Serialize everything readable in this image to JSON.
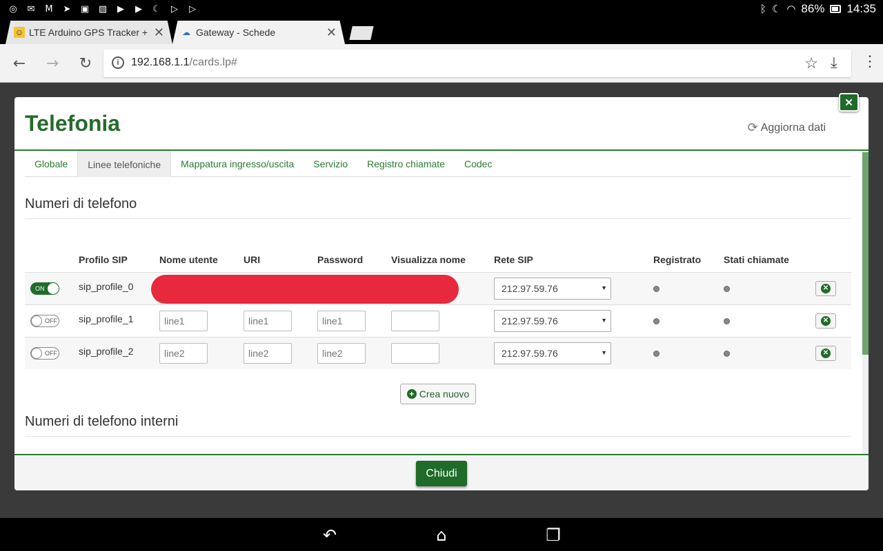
{
  "status_bar": {
    "battery": "86%",
    "time": "14:35"
  },
  "browser": {
    "tabs": [
      {
        "title": "LTE Arduino GPS Tracker + Io",
        "active": false
      },
      {
        "title": "Gateway - Schede",
        "active": true
      }
    ],
    "url_host": "192.168.1.1",
    "url_path": "/cards.lp#"
  },
  "modal": {
    "title": "Telefonia",
    "refresh_label": "Aggiorna dati",
    "close_label": "Chiudi",
    "tabs": [
      {
        "label": "Globale",
        "active": false
      },
      {
        "label": "Linee telefoniche",
        "active": true
      },
      {
        "label": "Mappatura ingresso/uscita",
        "active": false
      },
      {
        "label": "Servizio",
        "active": false
      },
      {
        "label": "Registro chiamate",
        "active": false
      },
      {
        "label": "Codec",
        "active": false
      }
    ],
    "section1_title": "Numeri di telefono",
    "section2_title": "Numeri di telefono interni",
    "table": {
      "headers": [
        "Profilo SIP",
        "Nome utente",
        "URI",
        "Password",
        "Visualizza nome",
        "Rete SIP",
        "Registrato",
        "Stati chiamate"
      ],
      "rows": [
        {
          "switch": "ON",
          "profile": "sip_profile_0",
          "username": "",
          "uri": "",
          "password": "",
          "display_name": "",
          "network": "212.97.59.76",
          "redacted": true
        },
        {
          "switch": "OFF",
          "profile": "sip_profile_1",
          "username": "line1",
          "uri": "line1",
          "password": "line1",
          "display_name": "",
          "network": "212.97.59.76",
          "redacted": false
        },
        {
          "switch": "OFF",
          "profile": "sip_profile_2",
          "username": "line2",
          "uri": "line2",
          "password": "line2",
          "display_name": "",
          "network": "212.97.59.76",
          "redacted": false
        }
      ]
    },
    "create_label": "Crea nuovo"
  },
  "colors": {
    "accent_green": "#1e6b2a",
    "title_green": "#246b2b",
    "redaction": "#e8283c"
  }
}
